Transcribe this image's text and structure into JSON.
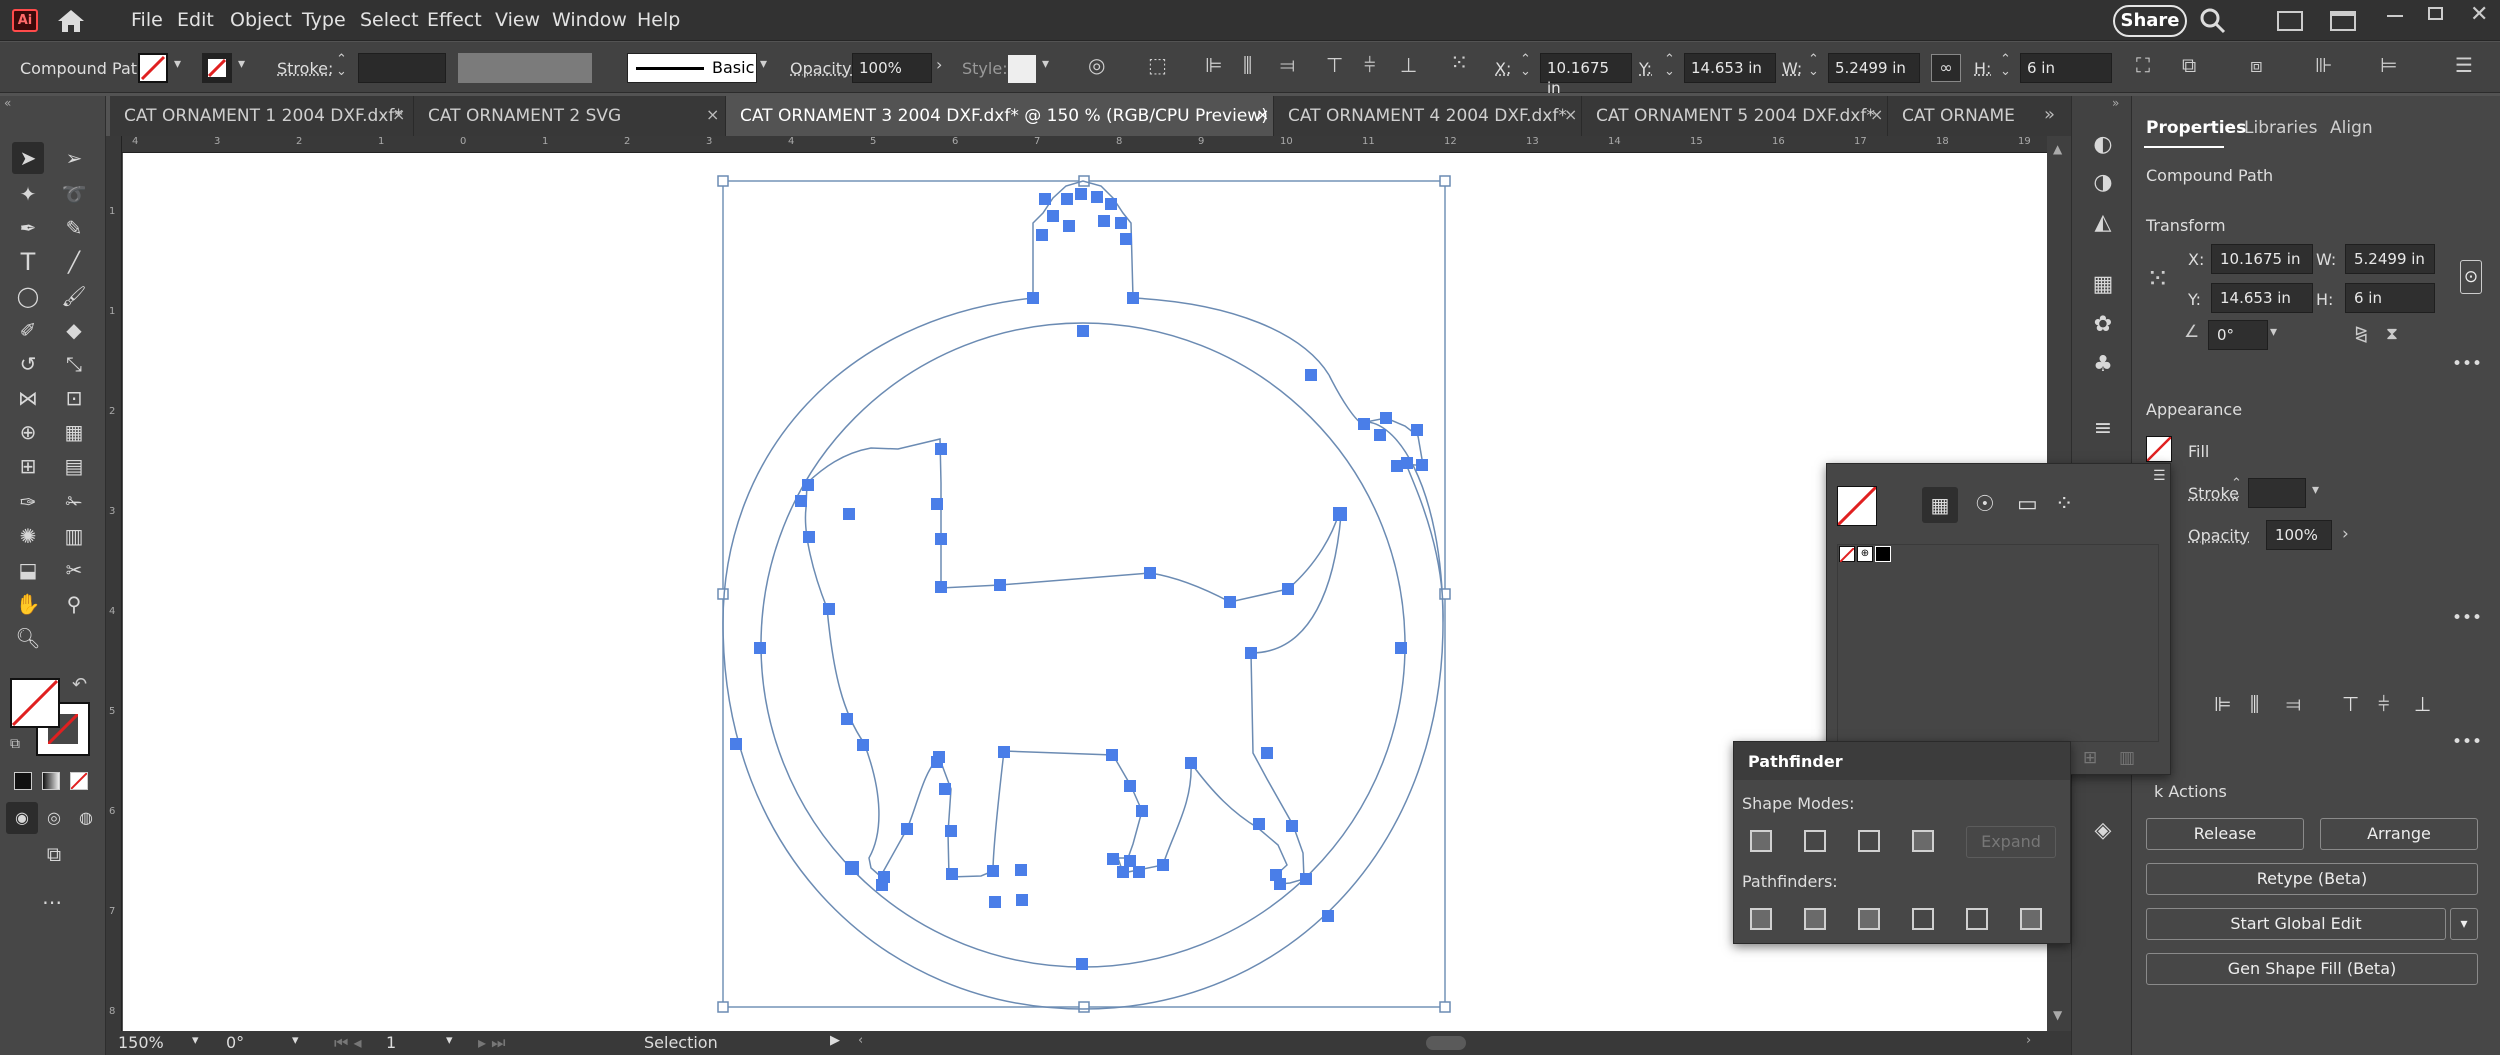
{
  "app": {
    "logo": "Ai"
  },
  "menu": [
    "File",
    "Edit",
    "Object",
    "Type",
    "Select",
    "Effect",
    "View",
    "Window",
    "Help"
  ],
  "share_label": "Share",
  "control": {
    "selection_type": "Compound Path",
    "stroke_label": "Stroke:",
    "brush_label": "Basic",
    "opacity_label": "Opacity:",
    "opacity_value": "100%",
    "style_label": "Style:",
    "x_label": "X:",
    "x_value": "10.1675 in",
    "y_label": "Y:",
    "y_value": "14.653 in",
    "w_label": "W:",
    "w_value": "5.2499 in",
    "h_label": "H:",
    "h_value": "6 in"
  },
  "tabs": [
    {
      "label": "CAT ORNAMENT 1 2004 DXF.dxf*",
      "close": "×"
    },
    {
      "label": "CAT ORNAMENT 2 SVG FILLED.svg*",
      "close": "×"
    },
    {
      "label": "CAT ORNAMENT 3 2004 DXF.dxf* @ 150 % (RGB/CPU Preview)",
      "close": "×"
    },
    {
      "label": "CAT ORNAMENT 4 2004 DXF.dxf*",
      "close": "×"
    },
    {
      "label": "CAT ORNAMENT 5 2004 DXF.dxf*",
      "close": "×"
    },
    {
      "label": "CAT ORNAME"
    }
  ],
  "ruler": {
    "h": [
      "4",
      "3",
      "2",
      "1",
      "0",
      "1",
      "2",
      "3",
      "4",
      "5",
      "6",
      "7",
      "8",
      "9",
      "10",
      "11",
      "12",
      "13",
      "14",
      "15",
      "16",
      "17",
      "18",
      "19",
      "20"
    ],
    "v": [
      "1",
      "1",
      "2",
      "3",
      "4",
      "5",
      "6",
      "7",
      "8"
    ]
  },
  "status": {
    "zoom": "150%",
    "rotation": "0°",
    "artboard": "1",
    "tool": "Selection"
  },
  "props": {
    "tab_properties": "Properties",
    "tab_libraries": "Libraries",
    "tab_align": "Align",
    "object_type": "Compound Path",
    "transform": "Transform",
    "x_label": "X:",
    "x_value": "10.1675 in",
    "w_label": "W:",
    "w_value": "5.2499 in",
    "y_label": "Y:",
    "y_value": "14.653 in",
    "h_label": "H:",
    "h_value": "6 in",
    "angle_value": "0°",
    "appearance": "Appearance",
    "fill_label": "Fill",
    "stroke_label": "Stroke",
    "opacity_label": "Opacity",
    "opacity_value": "100%",
    "align_partial": "n",
    "quick_actions_partial": "k Actions",
    "release": "Release",
    "arrange": "Arrange",
    "retype": "Retype (Beta)",
    "global_edit": "Start Global Edit",
    "gen_shape": "Gen Shape Fill (Beta)"
  },
  "pathfinder": {
    "title": "Pathfinder",
    "shape_modes": "Shape Modes:",
    "expand": "Expand",
    "pathfinders": "Pathfinders:"
  },
  "colors": {
    "accent": "#4a7ee8",
    "path": "#6b8bb3"
  }
}
